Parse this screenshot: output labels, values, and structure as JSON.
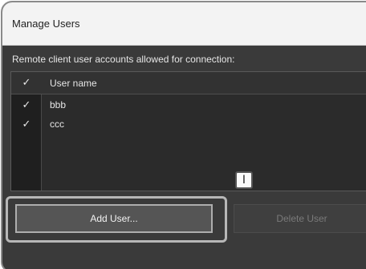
{
  "window": {
    "title": "Manage Users"
  },
  "prompt": "Remote client user accounts allowed for connection:",
  "list": {
    "header": {
      "checked": true,
      "column": "User name"
    },
    "rows": [
      {
        "checked": true,
        "name": "bbb"
      },
      {
        "checked": true,
        "name": "ccc"
      }
    ]
  },
  "callout": {
    "label": "I"
  },
  "buttons": {
    "add_user": "Add User...",
    "delete_user": "Delete User"
  },
  "icons": {
    "check": "checkmark-icon"
  },
  "colors": {
    "background": "#3a3a3a",
    "titlebar": "#f3f3f3",
    "highlight": "#b7b7b7"
  }
}
